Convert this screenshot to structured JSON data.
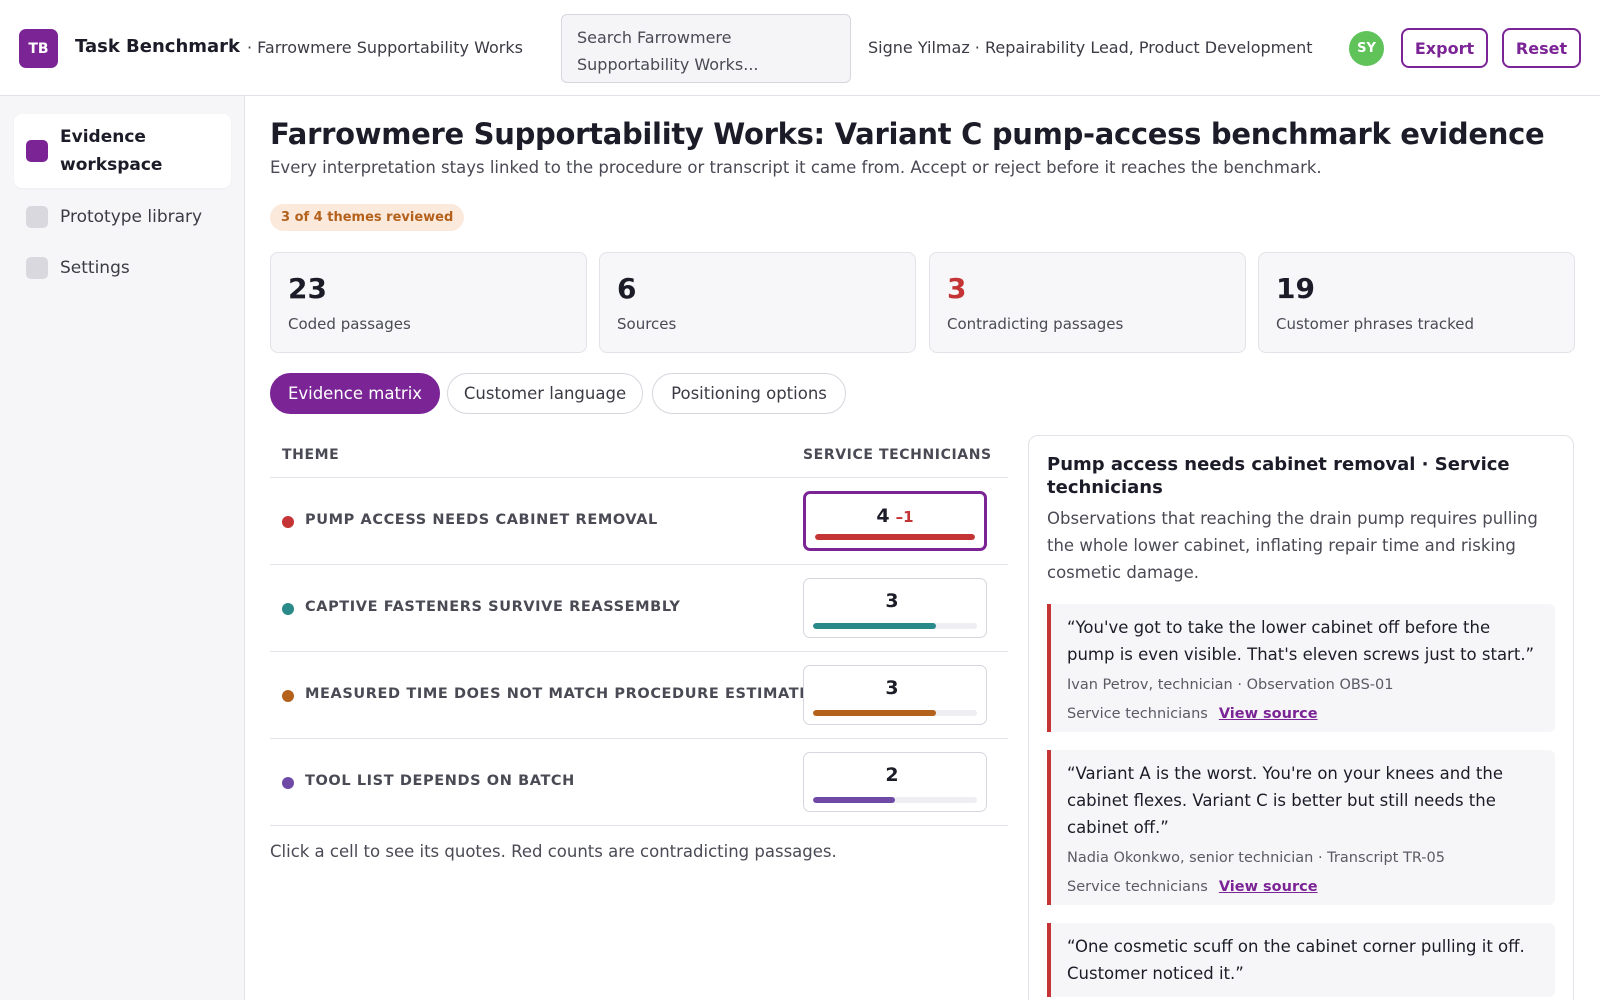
{
  "app": {
    "logo_text": "TB",
    "name": "Task Benchmark",
    "org_crumb": "· Farrowmere Supportability Works",
    "search_placeholder": "Search Farrowmere Supportability Works...",
    "user_label": "Signe Yilmaz · Repairability Lead, Product Development",
    "avatar_initials": "SY",
    "export_label": "Export",
    "reset_label": "Reset",
    "brand_color": "#7b2496"
  },
  "sidebar": {
    "items": [
      {
        "label": "Evidence workspace",
        "icon": "workspace-icon",
        "active": true
      },
      {
        "label": "Prototype library",
        "icon": "library-icon",
        "active": false
      },
      {
        "label": "Settings",
        "icon": "settings-icon",
        "active": false
      }
    ]
  },
  "page": {
    "title": "Farrowmere Supportability Works: Variant C pump-access benchmark evidence",
    "subtitle": "Every interpretation stays linked to the procedure or transcript it came from. Accept or reject before it reaches the benchmark.",
    "progress": "3 of 4 themes reviewed"
  },
  "stats": [
    {
      "value": "23",
      "label": "Coded passages",
      "alert": false
    },
    {
      "value": "6",
      "label": "Sources",
      "alert": false
    },
    {
      "value": "3",
      "label": "Contradicting passages",
      "alert": true
    },
    {
      "value": "19",
      "label": "Customer phrases tracked",
      "alert": false
    }
  ],
  "tabs": [
    {
      "label": "Evidence matrix",
      "active": true
    },
    {
      "label": "Customer language",
      "active": false
    },
    {
      "label": "Positioning options",
      "active": false
    }
  ],
  "matrix": {
    "theme_header": "THEME",
    "group_header": "SERVICE TECHNICIANS",
    "bar_max": 4,
    "rows": [
      {
        "theme": "PUMP ACCESS NEEDS CABINET REMOVAL",
        "color": "#c53434",
        "count": "4",
        "count_value": 4,
        "contradicting": "–1",
        "selected": true
      },
      {
        "theme": "CAPTIVE FASTENERS SURVIVE REASSEMBLY",
        "color": "#2a8a8a",
        "count": "3",
        "count_value": 3,
        "contradicting": "",
        "selected": false
      },
      {
        "theme": "MEASURED TIME DOES NOT MATCH PROCEDURE ESTIMATE",
        "color": "#b4611c",
        "count": "3",
        "count_value": 3,
        "contradicting": "",
        "selected": false
      },
      {
        "theme": "TOOL LIST DEPENDS ON BATCH",
        "color": "#6e4aa6",
        "count": "2",
        "count_value": 2,
        "contradicting": "",
        "selected": false
      }
    ],
    "hint": "Click a cell to see its quotes. Red counts are contradicting passages."
  },
  "panel": {
    "title": "Pump access needs cabinet removal · Service technicians",
    "description": "Observations that reaching the drain pump requires pulling the whole lower cabinet, inflating repair time and risking cosmetic damage.",
    "quotes": [
      {
        "text": "“You've got to take the lower cabinet off before the pump is even visible. That's eleven screws just to start.”",
        "meta": "Ivan Petrov, technician · Observation OBS-01",
        "group": "Service technicians",
        "link": "View source"
      },
      {
        "text": "“Variant A is the worst. You're on your knees and the cabinet flexes. Variant C is better but still needs the cabinet off.”",
        "meta": "Nadia Okonkwo, senior technician · Transcript TR-05",
        "group": "Service technicians",
        "link": "View source"
      },
      {
        "text": "“One cosmetic scuff on the cabinet corner pulling it off. Customer noticed it.”",
        "meta": "",
        "group": "",
        "link": ""
      }
    ]
  }
}
